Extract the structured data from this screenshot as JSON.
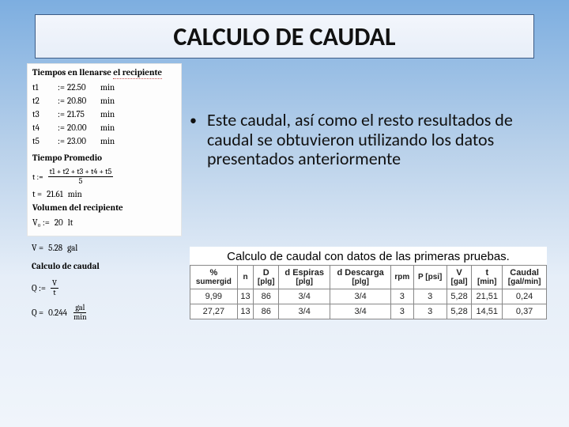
{
  "title": "CALCULO DE CAUDAL",
  "left": {
    "heading1_pre": "Tiempos en llenarse ",
    "heading1_ul": "el recipiente",
    "times": [
      {
        "lab": "t1",
        "val": "22.50",
        "unit": "min"
      },
      {
        "lab": "t2",
        "val": "20.80",
        "unit": "min"
      },
      {
        "lab": "t3",
        "val": "21.75",
        "unit": "min"
      },
      {
        "lab": "t4",
        "val": "20.00",
        "unit": "min"
      },
      {
        "lab": "t5",
        "val": "23.00",
        "unit": "min"
      }
    ],
    "heading2": "Tiempo Promedio",
    "avg_frac_top": "t1 + t2 + t3 + t4 + t5",
    "avg_frac_bot": "5",
    "avg_t_lab": "t :=",
    "avg_res_lab": "t =",
    "avg_res_val": "21.61",
    "avg_res_unit": "min",
    "heading3": "Volumen del recipiente",
    "vol_lab": "V₀ :=",
    "vol_val": "20",
    "vol_unit": "lt",
    "vol_conv_lhs": "V =",
    "vol_conv_val": "5.28",
    "vol_conv_unit": "gal",
    "heading4": "Calculo de caudal",
    "q_def_lhs": "Q :=",
    "q_frac_top": "V",
    "q_frac_bot": "t",
    "q_res_lhs": "Q =",
    "q_res_val": "0.244",
    "q_res_unit_top": "gal",
    "q_res_unit_bot": "min"
  },
  "bullet": "Este caudal, así como el resto resultados de caudal se obtuvieron utilizando los datos presentados anteriormente",
  "table": {
    "title": "Calculo de caudal con datos de las primeras pruebas.",
    "headers": [
      {
        "top": "%",
        "sub": "sumergid"
      },
      {
        "top": "",
        "sub": "n"
      },
      {
        "top": "D",
        "sub": "[plg]"
      },
      {
        "top": "d Espiras",
        "sub": "[plg]"
      },
      {
        "top": "d Descarga",
        "sub": "[plg]"
      },
      {
        "top": "",
        "sub": "rpm"
      },
      {
        "top": "",
        "sub": "P [psi]"
      },
      {
        "top": "V",
        "sub": "[gal]"
      },
      {
        "top": "t",
        "sub": "[min]"
      },
      {
        "top": "Caudal",
        "sub": "[gal/min]"
      }
    ],
    "rows": [
      [
        "9,99",
        "13",
        "86",
        "3/4",
        "3/4",
        "3",
        "3",
        "5,28",
        "21,51",
        "0,24"
      ],
      [
        "27,27",
        "13",
        "86",
        "3/4",
        "3/4",
        "3",
        "3",
        "5,28",
        "14,51",
        "0,37"
      ]
    ]
  }
}
